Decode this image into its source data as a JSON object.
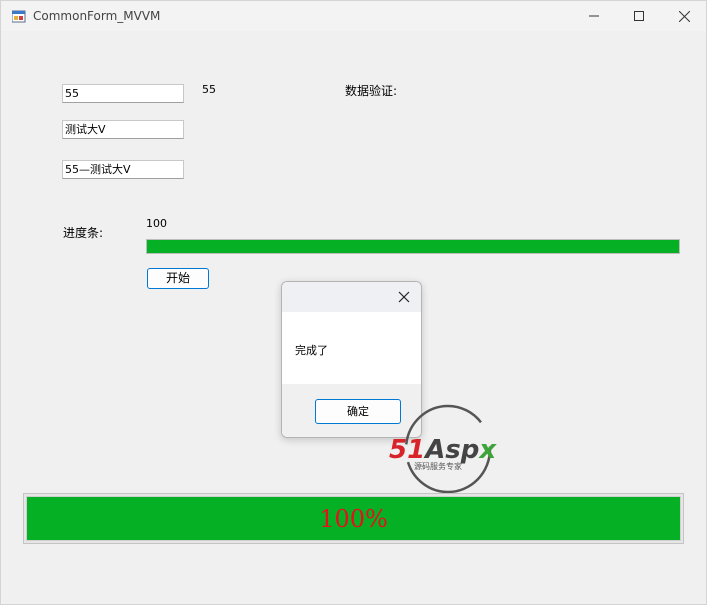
{
  "window": {
    "title": "CommonForm_MVVM"
  },
  "form": {
    "textbox1_value": "55",
    "label_value": "55",
    "validation_label": "数据验证:",
    "textbox2_value": "测试大V",
    "textbox3_value": "55—测试大V",
    "progress_label": "进度条:",
    "progress_value_text": "100",
    "progress_fraction": 1.0,
    "start_button": "开始"
  },
  "dialog": {
    "message": "完成了",
    "ok_button": "确定"
  },
  "bottom_progress": {
    "percent_text": "100%",
    "fraction": 1.0
  },
  "watermark": {
    "brand": "51Aspx",
    "tagline": "源码服务专家"
  },
  "colors": {
    "progress_fill": "#06b025",
    "percent_text": "#e5101c",
    "accent_border": "#0078d4"
  }
}
